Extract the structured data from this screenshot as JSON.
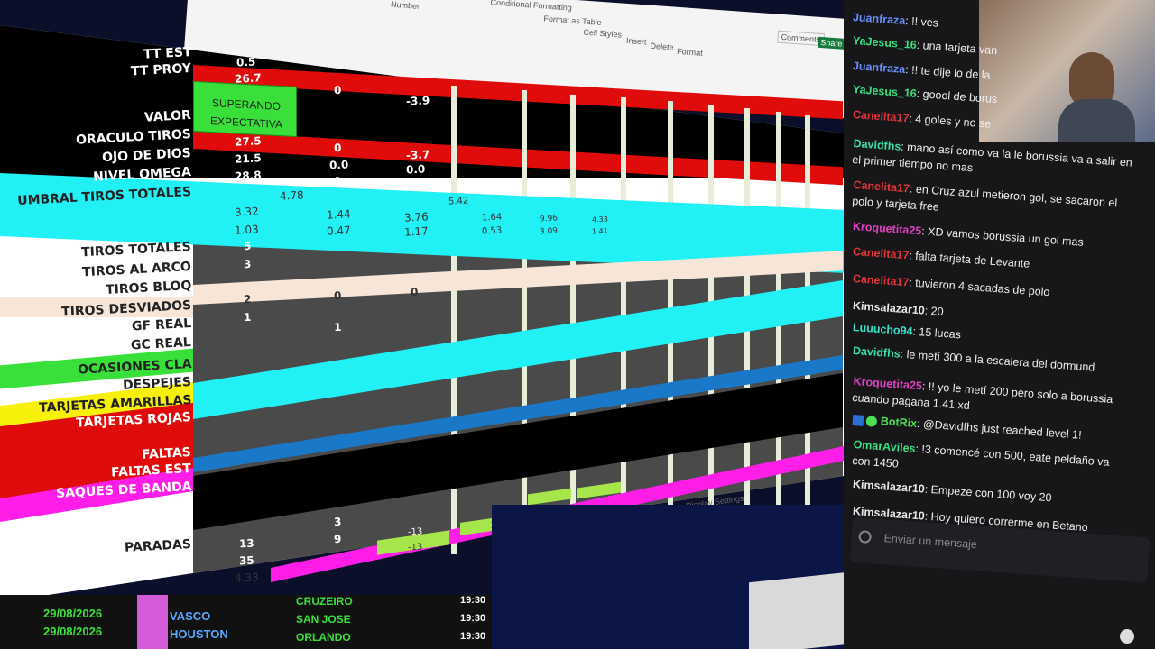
{
  "ribbon": {
    "number_label": "Number",
    "conditional_label": "Conditional Formatting",
    "format_as_table_label": "Format as Table",
    "cell_styles_label": "Cell Styles",
    "insert_label": "Insert",
    "delete_label": "Delete",
    "format_label": "Format",
    "comments_label": "Comments",
    "share_label": "Share",
    "display_settings_label": "Display Settings"
  },
  "sheet": {
    "labels": {
      "tt_est": "TT EST",
      "tt_proy": "TT PROY",
      "valor": "VALOR",
      "oraculo": "ORACULO TIROS",
      "ojo": "OJO DE DIOS",
      "nivel": "NIVEL OMEGA",
      "umbral": "UMBRAL TIROS TOTALES",
      "tiros_totales": "TIROS TOTALES",
      "tiros_arco": "TIROS AL ARCO",
      "tiros_bloq": "TIROS BLOQ",
      "tiros_desviados": "TIROS DESVIADOS",
      "gf_real": "GF REAL",
      "gc_real": "GC REAL",
      "ocasiones": "OCASIONES CLA",
      "despejes": "DESPEJES",
      "tarjetas_amarillas": "TARJETAS AMARILLAS",
      "tarjetas_rojas": "TARJETAS ROJAS",
      "faltas": "FALTAS",
      "faltas_est": "FALTAS EST",
      "saques": "SAQUES DE BANDA",
      "paradas": "PARADAS"
    },
    "badge": "SUPERANDO EXPECTATIVA",
    "values": {
      "tt_est": "0.5",
      "tt_proy": "26.7",
      "tt_proy_2": "0",
      "tt_proy_3": "-3.9",
      "oraculo": "27.5",
      "oraculo_2": "0",
      "oraculo_3": "-3.7",
      "ojo": "21.5",
      "ojo_2": "0.0",
      "ojo_3": "0.0",
      "nivel": "28.8",
      "nivel_2": "0",
      "nivel_3": "0",
      "umbral": "4.78",
      "umbral_b": "5.42",
      "r1": [
        "3.32",
        "1.44",
        "3.76",
        "1.64",
        "9.96",
        "4.33"
      ],
      "r2": [
        "1.03",
        "0.47",
        "1.17",
        "0.53",
        "3.09",
        "1.41"
      ],
      "tiros_totales": "5",
      "tiros_arco": "3",
      "tiros_desviados": "2",
      "tiros_desviados_2": "0",
      "tiros_desviados_3": "0",
      "gf_real": "1",
      "gc_real_2": "1",
      "paradas_a": "3",
      "paradas_b": "9",
      "paradas": "13",
      "paradas_2": "35",
      "paradas_3": "4.33",
      "neg1": "-13",
      "neg2": "-13",
      "neg3": "-3"
    }
  },
  "schedule": {
    "rows": [
      {
        "date": "29/08/2026",
        "home": "VASCO",
        "away": "CRUZEIRO",
        "time": "19:30"
      },
      {
        "date": "29/08/2026",
        "home": "HOUSTON",
        "away": "SAN JOSE",
        "time": "19:30"
      },
      {
        "date": "29/08/2026",
        "home": "",
        "away": "ORLANDO",
        "time": "19:30"
      }
    ]
  },
  "chat": {
    "messages": [
      {
        "user": "Juanfraza",
        "color": "#6a8dff",
        "text": "!! ves"
      },
      {
        "user": "YaJesus_16",
        "color": "#36e07a",
        "text": "una tarjeta van"
      },
      {
        "user": "Juanfraza",
        "color": "#6a8dff",
        "text": "!! te dije lo de la"
      },
      {
        "user": "YaJesus_16",
        "color": "#36e07a",
        "text": "goool de borus"
      },
      {
        "user": "Canelita17",
        "color": "#e0343a",
        "text": "4 goles y no se"
      },
      {
        "user": "Davidfhs",
        "color": "#36e0a0",
        "text": "mano así como va la le borussia va a salir en el primer tiempo no mas"
      },
      {
        "user": "Canelita17",
        "color": "#e0343a",
        "text": "en Cruz azul metieron gol, se sacaron el polo y tarjeta free"
      },
      {
        "user": "Kroquetita25",
        "color": "#e040c0",
        "text": "XD vamos borussia un gol mas"
      },
      {
        "user": "Canelita17",
        "color": "#e0343a",
        "text": "falta tarjeta de Levante"
      },
      {
        "user": "Canelita17",
        "color": "#e0343a",
        "text": "tuvieron 4 sacadas de polo"
      },
      {
        "user": "Kimsalazar10",
        "color": "#e8e8e8",
        "text": "20"
      },
      {
        "user": "Luuucho94",
        "color": "#36e0c0",
        "text": "15 lucas"
      },
      {
        "user": "Davidfhs",
        "color": "#36e0a0",
        "text": "le metí 300 a la escalera del dormund"
      },
      {
        "user": "Kroquetita25",
        "color": "#e040c0",
        "text": "!! yo le metí 200 pero solo a borussia cuando pagana 1.41 xd"
      },
      {
        "user": "BotRix",
        "color": "#4adf55",
        "text": "@Davidfhs just reached level 1!"
      },
      {
        "user": "OmarAviles",
        "color": "#36e07a",
        "text": "!3 comencé con 500, eate peldaño va con 1450"
      },
      {
        "user": "Kimsalazar10",
        "color": "#e8e8e8",
        "text": "Empeze con 100 voy 20"
      },
      {
        "user": "Kimsalazar10",
        "color": "#e8e8e8",
        "text": "Hoy quiero correrme en Betano"
      }
    ],
    "input_placeholder": "Enviar un mensaje"
  },
  "colors": {
    "cyan": "#21f0f5",
    "red": "#e00b0b",
    "green": "#3ae03a",
    "yellow": "#f7f00a",
    "magenta": "#ff1ee8",
    "blue": "#1a78c8",
    "salmon": "#f7e6d8"
  }
}
